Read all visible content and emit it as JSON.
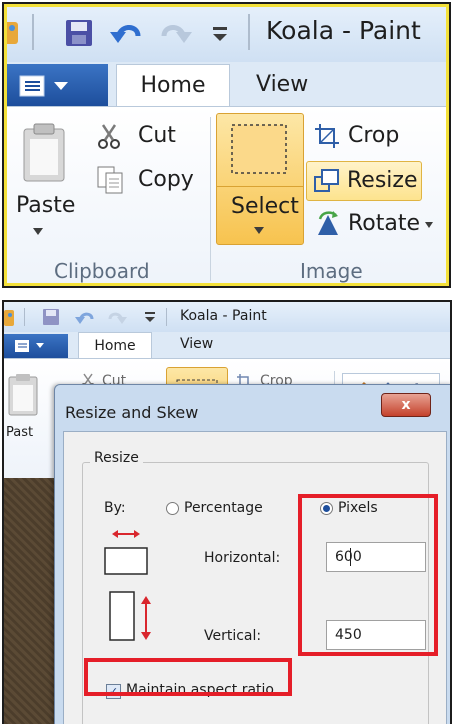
{
  "window_title": "Koala - Paint",
  "tabs": {
    "home": "Home",
    "view": "View"
  },
  "clipboard": {
    "paste": "Paste",
    "cut": "Cut",
    "copy": "Copy",
    "group_label": "Clipboard"
  },
  "image": {
    "select": "Select",
    "crop": "Crop",
    "resize": "Resize",
    "rotate": "Rotate",
    "group_label": "Image"
  },
  "bottom_ribbon": {
    "paste_truncated": "Past",
    "cut": "Cut",
    "crop": "Crop"
  },
  "dialog": {
    "title": "Resize and Skew",
    "close": "x",
    "group_title": "Resize",
    "by_label": "By:",
    "percentage": "Percentage",
    "pixels": "Pixels",
    "horizontal_label": "Horizontal:",
    "horizontal_value": "600",
    "vertical_label": "Vertical:",
    "vertical_value": "450",
    "maintain_aspect": "Maintain aspect ratio",
    "maintain_aspect_checked": true,
    "selected_unit": "pixels"
  },
  "colors": {
    "highlight_yellow": "#f4e13a",
    "highlight_red": "#e51e28",
    "ribbon_blue": "#1d4e9c",
    "active_orange": "#f9c95a"
  }
}
